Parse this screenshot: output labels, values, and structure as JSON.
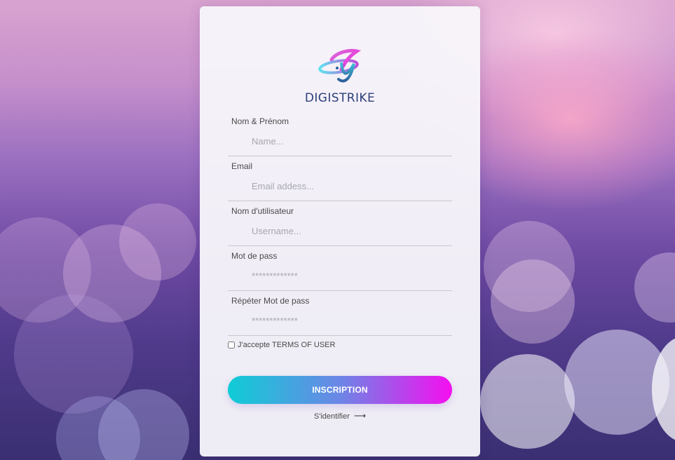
{
  "brand": {
    "logo_icon": "orbit-logo-icon",
    "name": "DIGISTRIKE"
  },
  "form": {
    "fields": [
      {
        "label": "Nom & Prénom",
        "placeholder": "Name..."
      },
      {
        "label": "Email",
        "placeholder": "Email addess..."
      },
      {
        "label": "Nom d'utilisateur",
        "placeholder": "Username..."
      },
      {
        "label": "Mot de pass",
        "placeholder": "*************"
      },
      {
        "label": "Répéter Mot de pass",
        "placeholder": "*************"
      }
    ],
    "terms_label": "J'accepte TERMS OF USER",
    "terms_checked": false,
    "submit_label": "INSCRIPTION",
    "signin_label": "S'identifier",
    "signin_icon": "arrow-right-icon"
  },
  "colors": {
    "button_gradient_start": "#0fcdd6",
    "button_gradient_end": "#f50ff0",
    "brand_text": "#2d3f7a",
    "card_background": "#f8f7fb"
  }
}
